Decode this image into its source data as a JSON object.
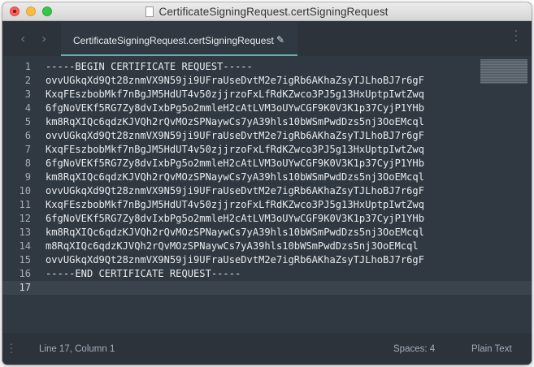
{
  "window": {
    "title": "CertificateSigningRequest.certSigningRequest"
  },
  "tabs": [
    {
      "label": "CertificateSigningRequest.certSigningRequest",
      "icon": "pencil-icon"
    }
  ],
  "editor": {
    "active_line": 17,
    "lines": [
      "-----BEGIN CERTIFICATE REQUEST-----",
      "ovvUGkqXd9Qt28znmVX9N59ji9UFraUseDvtM2e7igRb6AKhaZsyTJLhoBJ7r6gF",
      "KxqFEszbobMkf7nBgJM5HdUT4v50zjjrzoFxLfRdKZwco3PJ5g13HxUptpIwtZwq",
      "6fgNoVEKf5RG7Zy8dvIxbPg5o2mmleH2cAtLVM3oUYwCGF9K0V3K1p37CyjP1YHb",
      "km8RqXIQc6qdzKJVQh2rQvMOzSPNaywCs7yA39hls10bWSmPwdDzs5nj3OoEMcql",
      "ovvUGkqXd9Qt28znmVX9N59ji9UFraUseDvtM2e7igRb6AKhaZsyTJLhoBJ7r6gF",
      "KxqFEszbobMkf7nBgJM5HdUT4v50zjjrzoFxLfRdKZwco3PJ5g13HxUptpIwtZwq",
      "6fgNoVEKf5RG7Zy8dvIxbPg5o2mmleH2cAtLVM3oUYwCGF9K0V3K1p37CyjP1YHb",
      "km8RqXIQc6qdzKJVQh2rQvMOzSPNaywCs7yA39hls10bWSmPwdDzs5nj3OoEMcql",
      "ovvUGkqXd9Qt28znmVX9N59ji9UFraUseDvtM2e7igRb6AKhaZsyTJLhoBJ7r6gF",
      "KxqFEszbobMkf7nBgJM5HdUT4v50zjjrzoFxLfRdKZwco3PJ5g13HxUptpIwtZwq",
      "6fgNoVEKf5RG7Zy8dvIxbPg5o2mmleH2cAtLVM3oUYwCGF9K0V3K1p37CyjP1YHb",
      "km8RqXIQc6qdzKJVQh2rQvMOzSPNaywCs7yA39hls10bWSmPwdDzs5nj3OoEMcql",
      "m8RqXIQc6qdzKJVQh2rQvMOzSPNaywCs7yA39hls10bWSmPwdDzs5nj3OoEMcql",
      "ovvUGkqXd9Qt28znmVX9N59ji9UFraUseDvtM2e7igRb6AKhaZsyTJLhoBJ7r6gF",
      "-----END CERTIFICATE REQUEST-----",
      ""
    ]
  },
  "statusbar": {
    "position": "Line 17, Column 1",
    "spaces": "Spaces: 4",
    "syntax": "Plain Text"
  },
  "colors": {
    "editor_bg": "#303841",
    "tab_accent": "#5fb3b3",
    "text": "#e8ecef",
    "gutter_text": "#a7adba"
  }
}
